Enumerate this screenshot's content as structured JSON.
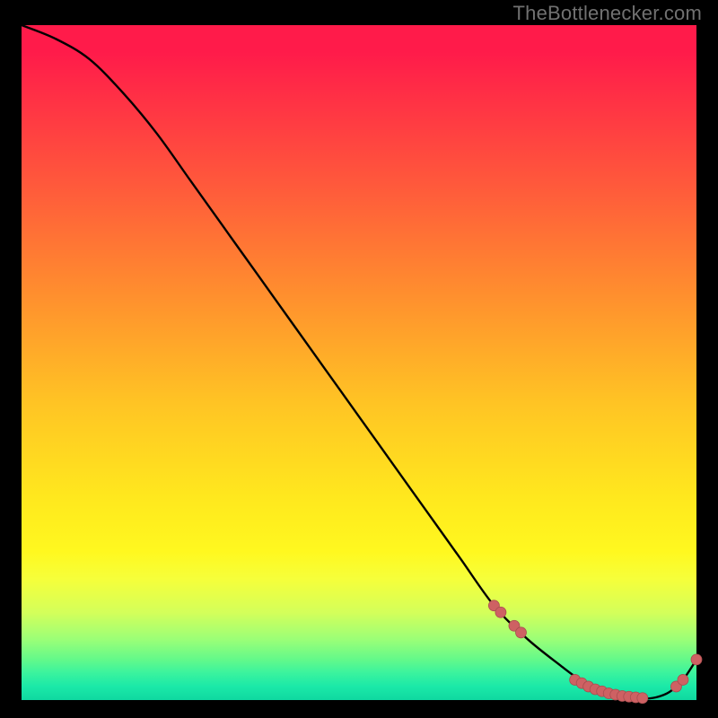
{
  "attribution": "TheBottlenecker.com",
  "colors": {
    "page_bg": "#000000",
    "text": "#717171",
    "curve": "#000000",
    "marker_fill": "#ce6163",
    "marker_stroke": "#a84d4f",
    "gradient_top": "#ff1b4a",
    "gradient_bottom": "#0fd8a0"
  },
  "chart_data": {
    "type": "line",
    "title": "",
    "xlabel": "",
    "ylabel": "",
    "xlim": [
      0,
      100
    ],
    "ylim": [
      0,
      100
    ],
    "grid": false,
    "legend": false,
    "x": [
      0,
      5,
      10,
      15,
      20,
      25,
      30,
      35,
      40,
      45,
      50,
      55,
      60,
      65,
      70,
      75,
      80,
      82,
      84,
      86,
      88,
      90,
      92,
      94,
      96,
      98,
      100
    ],
    "values": [
      100,
      98,
      95,
      90,
      84,
      77,
      70,
      63,
      56,
      49,
      42,
      35,
      28,
      21,
      14,
      9,
      5,
      3.5,
      2.3,
      1.4,
      0.8,
      0.4,
      0.2,
      0.4,
      1.2,
      3.0,
      6.0
    ],
    "markers": [
      {
        "x": 70.0,
        "y": 14.0
      },
      {
        "x": 71.0,
        "y": 13.0
      },
      {
        "x": 73.0,
        "y": 11.0
      },
      {
        "x": 74.0,
        "y": 10.0
      },
      {
        "x": 82.0,
        "y": 3.0
      },
      {
        "x": 83.0,
        "y": 2.5
      },
      {
        "x": 84.0,
        "y": 2.0
      },
      {
        "x": 85.0,
        "y": 1.6
      },
      {
        "x": 86.0,
        "y": 1.3
      },
      {
        "x": 87.0,
        "y": 1.0
      },
      {
        "x": 88.0,
        "y": 0.8
      },
      {
        "x": 89.0,
        "y": 0.6
      },
      {
        "x": 90.0,
        "y": 0.5
      },
      {
        "x": 91.0,
        "y": 0.4
      },
      {
        "x": 92.0,
        "y": 0.3
      },
      {
        "x": 97.0,
        "y": 2.0
      },
      {
        "x": 98.0,
        "y": 3.0
      },
      {
        "x": 100.0,
        "y": 6.0
      }
    ]
  }
}
